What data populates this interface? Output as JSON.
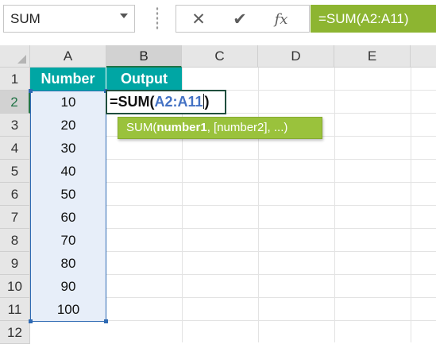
{
  "formula_bar": {
    "name_box": "SUM",
    "cancel_icon": "cancel-x-icon",
    "enter_icon": "checkmark-icon",
    "fx_label": "fx",
    "formula": "=SUM(A2:A11)"
  },
  "columns": [
    "A",
    "B",
    "C",
    "D",
    "E"
  ],
  "rows": [
    "1",
    "2",
    "3",
    "4",
    "5",
    "6",
    "7",
    "8",
    "9",
    "10",
    "11",
    "12"
  ],
  "headers": {
    "a1": "Number",
    "b1": "Output"
  },
  "values": [
    "10",
    "20",
    "30",
    "40",
    "50",
    "60",
    "70",
    "80",
    "90",
    "100"
  ],
  "editing_cell": {
    "prefix": "=SUM(",
    "range": "A2:A11",
    "suffix": ")"
  },
  "tooltip": {
    "fn": "SUM(",
    "arg1": "number1",
    "rest": ", [number2], ...)"
  },
  "colors": {
    "header_fill": "#00a6a4",
    "range_fill": "#e7eef9",
    "formula_fill": "#8db531",
    "tooltip_fill": "#9ac23c",
    "range_ref": "#4472c4"
  }
}
